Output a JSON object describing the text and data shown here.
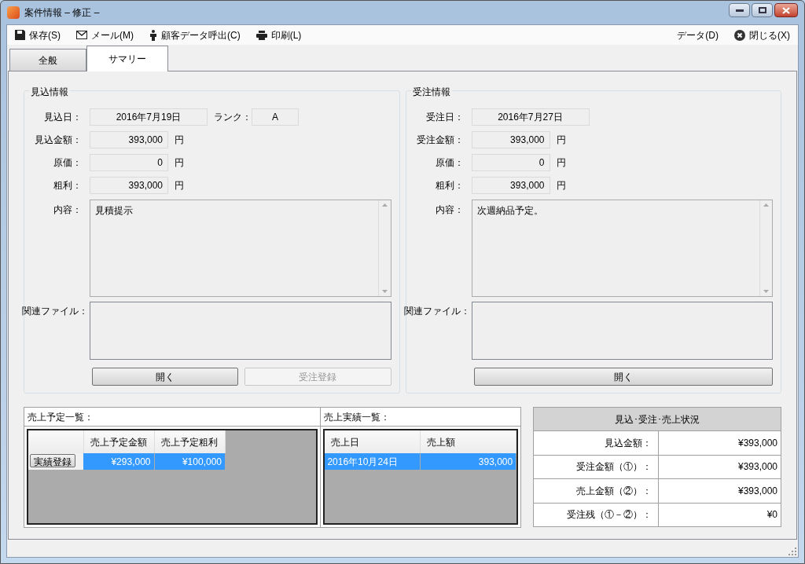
{
  "window": {
    "title": "案件情報 – 修正 –"
  },
  "toolbar": {
    "left": [
      {
        "kind": "save",
        "label": "保存(S)"
      },
      {
        "kind": "mail",
        "label": "メール(M)"
      },
      {
        "kind": "person",
        "label": "顧客データ呼出(C)"
      },
      {
        "kind": "print",
        "label": "印刷(L)"
      }
    ],
    "right": [
      {
        "kind": "text",
        "label": "データ(D)"
      },
      {
        "kind": "close",
        "label": "閉じる(X)"
      }
    ]
  },
  "tabs": [
    {
      "label": "全般",
      "selected": false
    },
    {
      "label": "サマリー",
      "selected": true
    }
  ],
  "panels": [
    {
      "title": "見込情報",
      "fields": [
        {
          "kind": "date",
          "label": "見込日：",
          "value": "2016年7月19日"
        },
        {
          "kind": "amount",
          "label": "見込金額：",
          "value": "393,000",
          "unit": "円"
        },
        {
          "kind": "amount",
          "label": "原価：",
          "value": "0",
          "unit": "円"
        },
        {
          "kind": "amount",
          "label": "粗利：",
          "value": "393,000",
          "unit": "円"
        }
      ],
      "rank": {
        "label": "ランク：",
        "value": "A"
      },
      "content_label": "内容：",
      "content": "見積提示",
      "files_label": "関連ファイル：",
      "buttons": [
        {
          "label": "開く",
          "disabled": false
        },
        {
          "label": "受注登録",
          "disabled": true
        }
      ]
    },
    {
      "title": "受注情報",
      "fields": [
        {
          "kind": "date",
          "label": "受注日：",
          "value": "2016年7月27日"
        },
        {
          "kind": "amount",
          "label": "受注金額：",
          "value": "393,000",
          "unit": "円"
        },
        {
          "kind": "amount",
          "label": "原価：",
          "value": "0",
          "unit": "円"
        },
        {
          "kind": "amount",
          "label": "粗利：",
          "value": "393,000",
          "unit": "円"
        }
      ],
      "content_label": "内容：",
      "content": "次週納品予定。",
      "files_label": "関連ファイル：",
      "buttons": [
        {
          "label": "開く",
          "disabled": false
        }
      ]
    }
  ],
  "sales_plan": {
    "title": "売上予定一覧：",
    "columns": [
      "売上予定金額",
      "売上予定粗利"
    ],
    "rows": [
      {
        "button": "実績登録",
        "amount": "¥293,000",
        "profit": "¥100,000",
        "selected": true
      }
    ]
  },
  "sales_actual": {
    "title": "売上実績一覧：",
    "columns": [
      "売上日",
      "売上額"
    ],
    "rows": [
      {
        "date": "2016年10月24日",
        "amount": "393,000",
        "selected": true
      }
    ]
  },
  "status": {
    "title": "見込･受注･売上状況",
    "rows": [
      {
        "label": "見込金額：",
        "value": "¥393,000"
      },
      {
        "label": "受注金額（①）：",
        "value": "¥393,000"
      },
      {
        "label": "売上金額（②）：",
        "value": "¥393,000"
      },
      {
        "label": "受注残（①－②）：",
        "value": "¥0"
      }
    ]
  }
}
